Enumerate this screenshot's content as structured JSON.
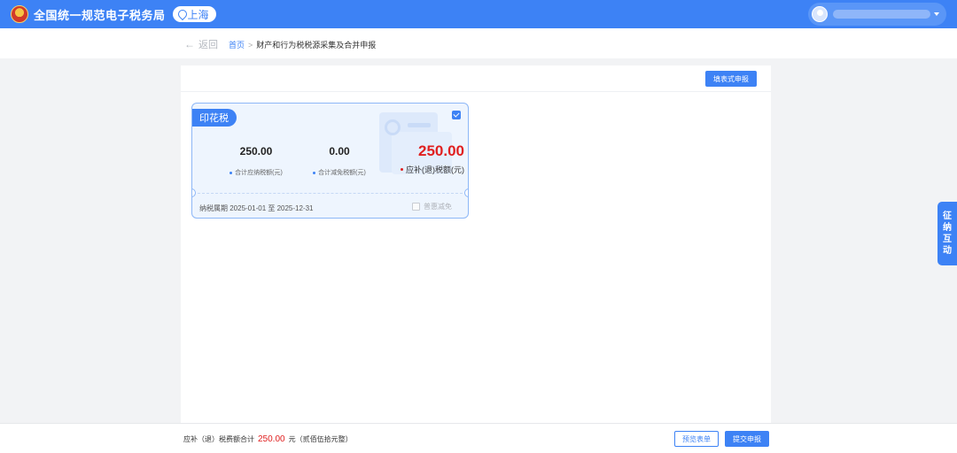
{
  "header": {
    "site_title": "全国统一规范电子税务局",
    "region": "上海"
  },
  "breadcrumb": {
    "back_label": "返回",
    "home": "首页",
    "separator": ">",
    "current": "财产和行为税税源采集及合并申报"
  },
  "main": {
    "fill_form_button": "填表式申报",
    "card": {
      "tax_name": "印花税",
      "checked": true,
      "payable_total": {
        "value": "250.00",
        "label": "合计应纳税额(元)"
      },
      "reduction_total": {
        "value": "0.00",
        "label": "合计减免税额(元)"
      },
      "refund_payable": {
        "value": "250.00",
        "label": "应补(退)税额(元)"
      },
      "period": "纳税属期 2025-01-01 至 2025-12-31",
      "relief_label": "普惠减免"
    }
  },
  "float_tab": [
    "征",
    "纳",
    "互",
    "动"
  ],
  "footer": {
    "total_label": "应补（退）税费额合计",
    "total_amount": "250.00",
    "total_unit": "元（贰佰伍拾元整）",
    "preview_button": "预览表单",
    "submit_button": "提交申报"
  },
  "colors": {
    "primary": "#3d82f5",
    "amount_red": "#e02020"
  }
}
